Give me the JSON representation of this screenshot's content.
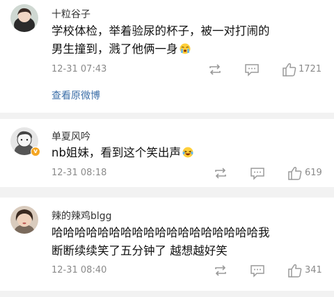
{
  "colors": {
    "page_bg": "#f2f2f2",
    "card_bg": "#ffffff",
    "meta": "#8a8a8a",
    "link": "#3d6fa8",
    "text": "#111111"
  },
  "comments": [
    {
      "username": "十粒谷子",
      "lines": [
        "学校体检，举着验尿的杯子，被一对打闹的",
        "男生撞到，溅了他俩一身"
      ],
      "emoji": "crying-face-emoji",
      "time": "12-31 07:43",
      "likes": "1721",
      "link": "查看原微博"
    },
    {
      "username": "单夏风吟",
      "lines": [
        "nb姐妹，看到这个笑出声"
      ],
      "emoji": "laughing-tears-emoji",
      "verified_icon": "verified-badge-icon",
      "time": "12-31 08:18",
      "likes": "619"
    },
    {
      "username": "辣的辣鸡blgg",
      "lines": [
        "哈哈哈哈哈哈哈哈哈哈哈哈哈哈哈哈哈哈我",
        "断断续续笑了五分钟了 越想越好笑"
      ],
      "time": "12-31 08:40",
      "likes": "341"
    }
  ],
  "icons": {
    "repost": "repost-icon",
    "comment": "comment-icon",
    "like": "thumbs-up-icon"
  }
}
